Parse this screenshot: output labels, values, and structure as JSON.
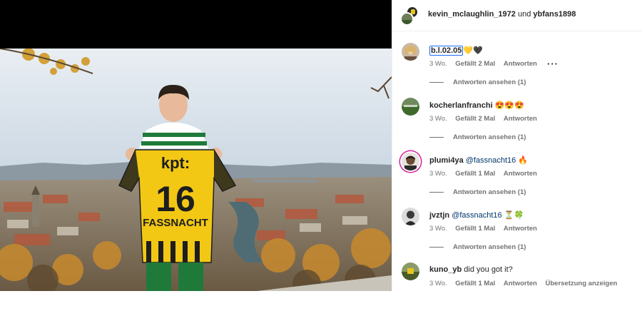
{
  "header": {
    "user1": "kevin_mclaughlin_1972",
    "connector": "und",
    "user2": "ybfans1898"
  },
  "photo": {
    "shirt_sponsor": "kpt:",
    "shirt_number": "16",
    "shirt_name": "FASSNACHT"
  },
  "comments": [
    {
      "username": "b.l.02.05",
      "mention": "",
      "text": "💛🖤",
      "age": "3 Wo.",
      "likes": "Gefällt 2 Mal",
      "reply": "Antworten",
      "translate": "",
      "replies": "Antworten ansehen (1)",
      "more": "···"
    },
    {
      "username": "kocherlanfranchi",
      "mention": "",
      "text": "😍😍😍",
      "age": "3 Wo.",
      "likes": "Gefällt 2 Mal",
      "reply": "Antworten",
      "translate": "",
      "replies": "Antworten ansehen (1)"
    },
    {
      "username": "plumi4ya",
      "mention": "@fassnacht16",
      "text": "🔥",
      "age": "3 Wo.",
      "likes": "Gefällt 1 Mal",
      "reply": "Antworten",
      "translate": "",
      "replies": "Antworten ansehen (1)"
    },
    {
      "username": "jvztjn",
      "mention": "@fassnacht16",
      "text": "⏳🍀",
      "age": "3 Wo.",
      "likes": "Gefällt 1 Mal",
      "reply": "Antworten",
      "translate": "",
      "replies": "Antworten ansehen (1)"
    },
    {
      "username": "kuno_yb",
      "mention": "",
      "text": "did you got it?",
      "age": "3 Wo.",
      "likes": "Gefällt 1 Mal",
      "reply": "Antworten",
      "translate": "Übersetzung anzeigen",
      "replies": ""
    }
  ],
  "colors": {
    "accent_link": "#00376b",
    "jersey_yellow": "#f2c814",
    "story_ring": "#d6249f"
  }
}
